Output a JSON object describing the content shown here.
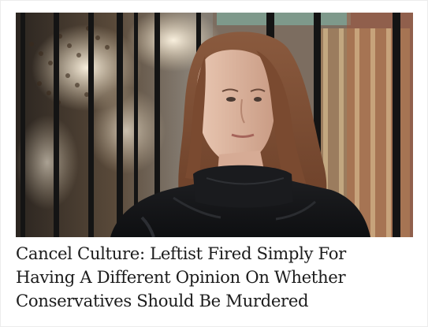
{
  "article": {
    "image_alt": "woman with auburn hair in a dark jacket standing by a black iron fence",
    "headline_lines": [
      "Cancel Culture: Leftist Fired Simply For",
      "Having A Different Opinion On Whether",
      "Conservatives Should Be Murdered"
    ]
  },
  "colors": {
    "headline_text": "#1c1c1c",
    "background": "#ffffff"
  }
}
